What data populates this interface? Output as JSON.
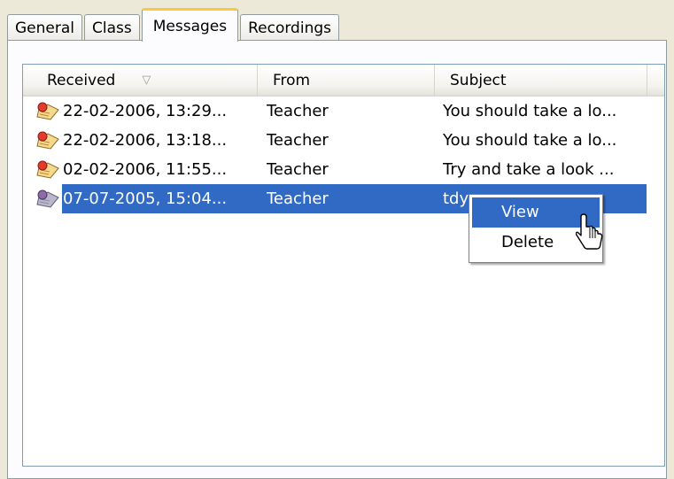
{
  "tabs": [
    {
      "label": "General"
    },
    {
      "label": "Class"
    },
    {
      "label": "Messages"
    },
    {
      "label": "Recordings"
    }
  ],
  "active_tab": "Messages",
  "columns": [
    {
      "label": "Received",
      "sort_indicator": "▽"
    },
    {
      "label": "From"
    },
    {
      "label": "Subject"
    }
  ],
  "messages": [
    {
      "received": "22-02-2006, 13:29...",
      "from": "Teacher",
      "subject": "You should take a lo...",
      "icon": "unread-message-icon"
    },
    {
      "received": "22-02-2006, 13:18...",
      "from": "Teacher",
      "subject": "You should take a lo...",
      "icon": "unread-message-icon"
    },
    {
      "received": "02-02-2006, 11:55...",
      "from": "Teacher",
      "subject": "Try and take a look ...",
      "icon": "unread-message-icon"
    },
    {
      "received": "07-07-2005, 15:04...",
      "from": "Teacher",
      "subject": "tdy",
      "icon": "read-message-icon",
      "selected": true
    }
  ],
  "context_menu": {
    "items": [
      {
        "label": "View",
        "highlighted": true
      },
      {
        "label": "Delete"
      }
    ]
  },
  "colors": {
    "selection": "#316ac5",
    "active_tab_accent": "#ffc83c",
    "window_bg": "#ece9d8"
  }
}
